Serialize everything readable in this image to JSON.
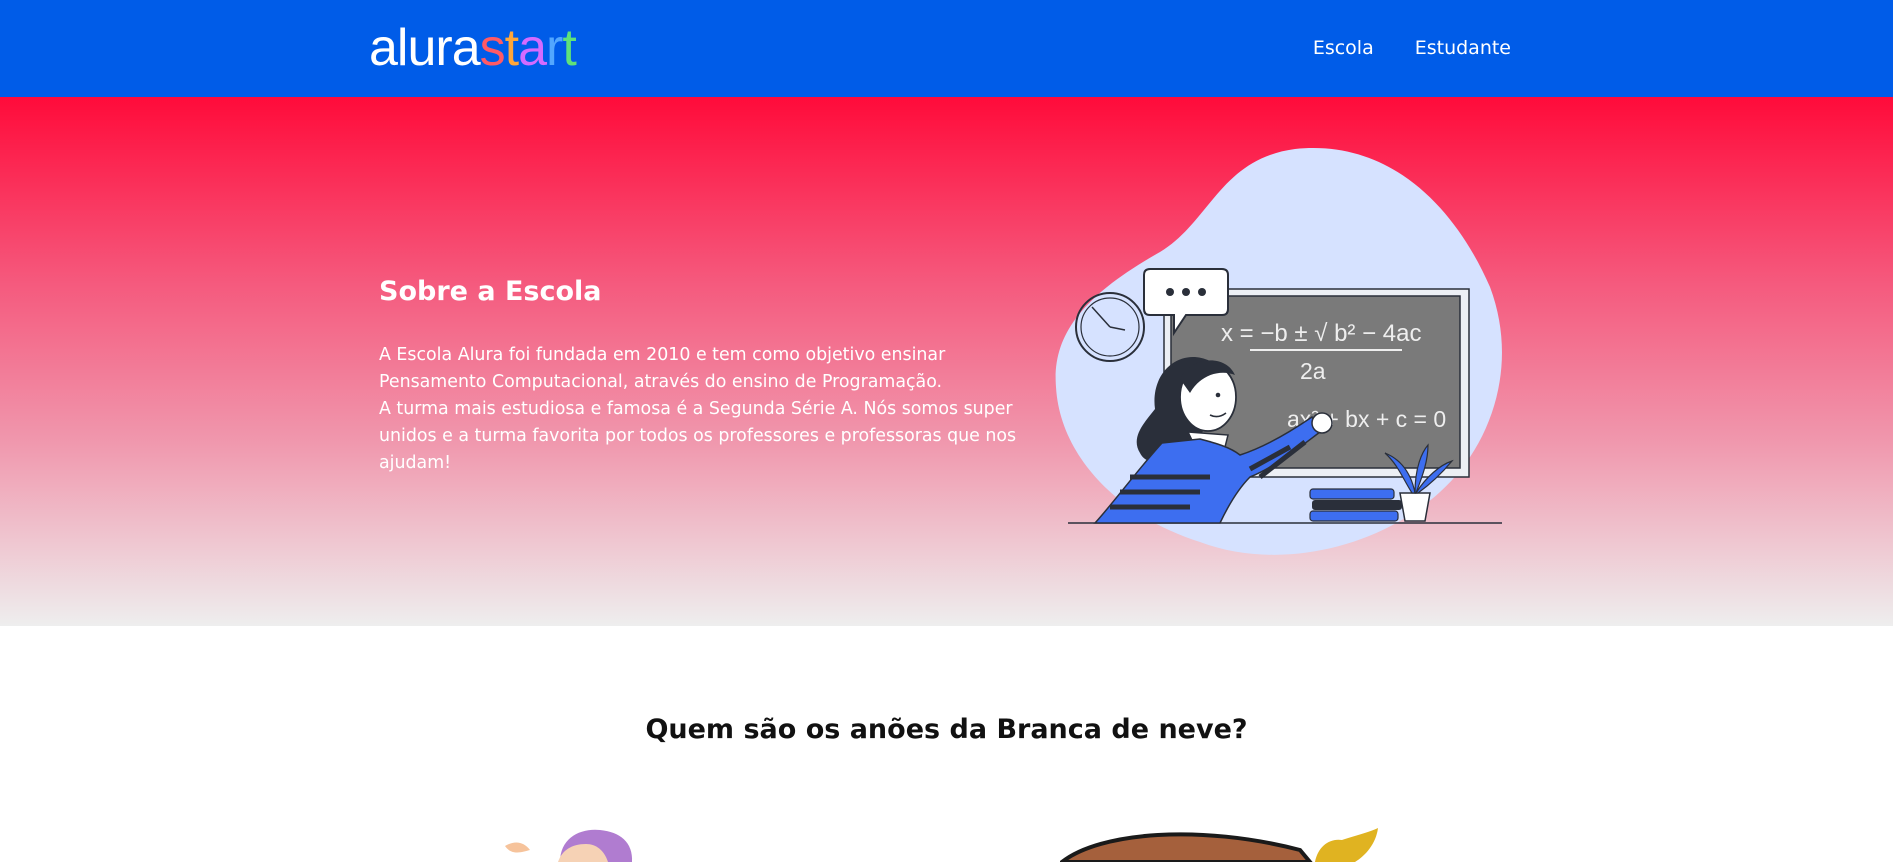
{
  "header": {
    "logo": {
      "part1": "alura",
      "part2": [
        "s",
        "t",
        "a",
        "r",
        "t"
      ]
    },
    "nav": [
      {
        "label": "Escola"
      },
      {
        "label": "Estudante"
      }
    ]
  },
  "hero": {
    "title": "Sobre a Escola",
    "paragraph1": "A Escola Alura foi fundada em 2010 e tem como objetivo ensinar Pensamento Computacional, através do ensino de Programação.",
    "paragraph2": "A turma mais estudiosa e famosa é a Segunda Série A. Nós somos super unidos e a turma favorita por todos os professores e professoras que nos ajudam!",
    "illustration": {
      "formula_top": "x = −b ± √ b² − 4ac",
      "formula_den": "2a",
      "formula_eq": "ax² + bx + c = 0"
    }
  },
  "section": {
    "title": "Quem são os anões da Branca de neve?"
  },
  "colors": {
    "header_bg": "#005ce8",
    "hero_top": "#ff0b3a",
    "hero_bottom": "#eeeeee",
    "logo_start": [
      "#ff4f5e",
      "#ff9f2e",
      "#c84fff",
      "#4fa8ff",
      "#4fe06a"
    ]
  }
}
